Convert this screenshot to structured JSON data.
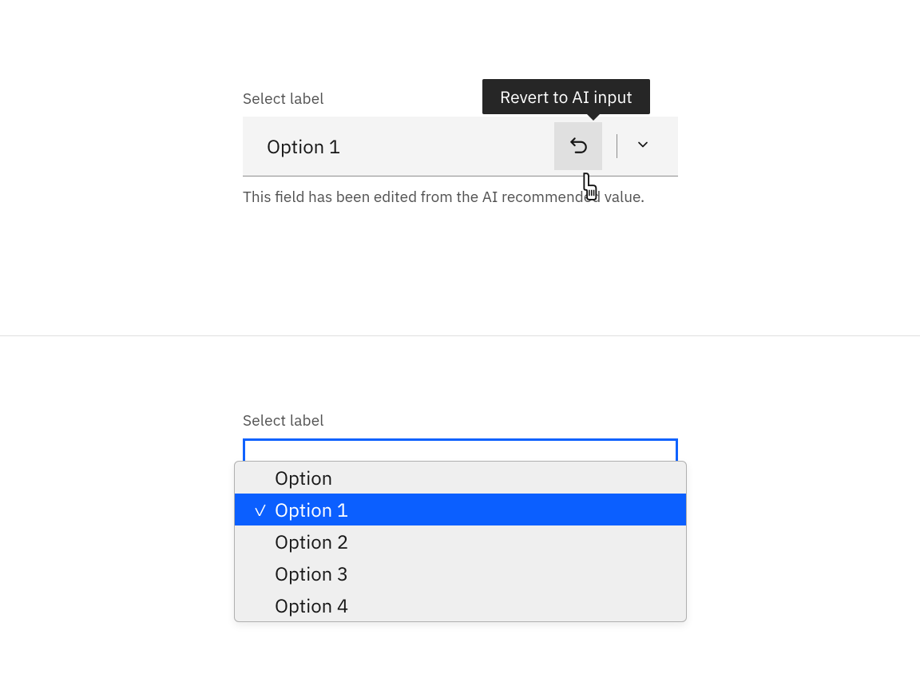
{
  "panel1": {
    "label": "Select label",
    "value": "Option 1",
    "tooltip": "Revert to AI input",
    "helper": "This field has been edited from the AI recommended value."
  },
  "panel2": {
    "label": "Select label",
    "options": [
      {
        "label": "Option",
        "selected": false
      },
      {
        "label": "Option 1",
        "selected": true
      },
      {
        "label": "Option 2",
        "selected": false
      },
      {
        "label": "Option 3",
        "selected": false
      },
      {
        "label": "Option 4",
        "selected": false
      }
    ]
  }
}
